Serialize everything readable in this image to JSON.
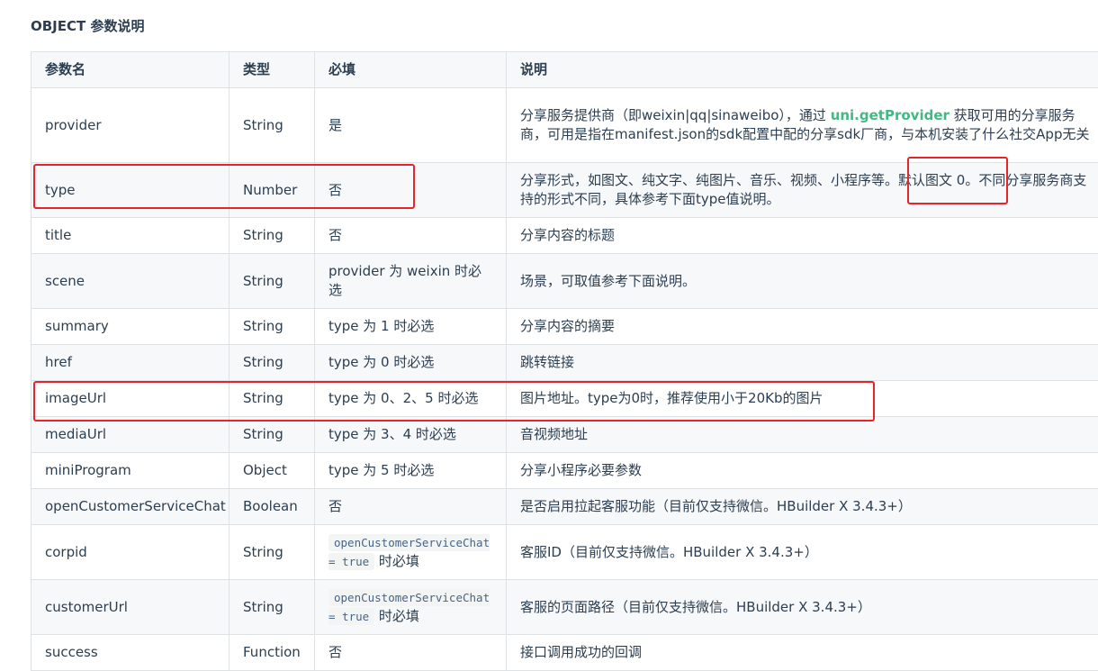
{
  "title": "OBJECT 参数说明",
  "headers": {
    "name": "参数名",
    "type": "类型",
    "required": "必填",
    "desc": "说明"
  },
  "rows": [
    {
      "name": "provider",
      "type": "String",
      "required": "是",
      "desc_pre": "分享服务提供商（即weixin|qq|sinaweibo），通过 ",
      "desc_link": "uni.getProvider",
      "desc_post": " 获取可用的分享服务商，可用是指在manifest.json的sdk配置中配的分享sdk厂商，与本机安装了什么社交App无关"
    },
    {
      "name": "type",
      "type": "Number",
      "required": "否",
      "desc": "分享形式，如图文、纯文字、纯图片、音乐、视频、小程序等。默认图文 0。不同分享服务商支持的形式不同，具体参考下面type值说明。"
    },
    {
      "name": "title",
      "type": "String",
      "required": "否",
      "desc": "分享内容的标题"
    },
    {
      "name": "scene",
      "type": "String",
      "required": "provider 为 weixin 时必选",
      "desc": "场景，可取值参考下面说明。"
    },
    {
      "name": "summary",
      "type": "String",
      "required": "type 为 1 时必选",
      "desc": "分享内容的摘要"
    },
    {
      "name": "href",
      "type": "String",
      "required": "type 为 0 时必选",
      "desc": "跳转链接"
    },
    {
      "name": "imageUrl",
      "type": "String",
      "required": "type 为 0、2、5 时必选",
      "desc": "图片地址。type为0时，推荐使用小于20Kb的图片"
    },
    {
      "name": "mediaUrl",
      "type": "String",
      "required": "type 为 3、4 时必选",
      "desc": "音视频地址"
    },
    {
      "name": "miniProgram",
      "type": "Object",
      "required": "type 为 5 时必选",
      "desc": "分享小程序必要参数"
    },
    {
      "name": "openCustomerServiceChat",
      "type": "Boolean",
      "required": "否",
      "desc": "是否启用拉起客服功能（目前仅支持微信。HBuilder X 3.4.3+）"
    },
    {
      "name": "corpid",
      "type": "String",
      "required_code": "openCustomerServiceChat = true",
      "required_post": " 时必填",
      "desc": "客服ID（目前仅支持微信。HBuilder X 3.4.3+）"
    },
    {
      "name": "customerUrl",
      "type": "String",
      "required_code": "openCustomerServiceChat = true",
      "required_post": " 时必填",
      "desc": "客服的页面路径（目前仅支持微信。HBuilder X 3.4.3+）"
    },
    {
      "name": "success",
      "type": "Function",
      "required": "否",
      "desc": "接口调用成功的回调"
    }
  ],
  "annotation_color": "#e5252a"
}
